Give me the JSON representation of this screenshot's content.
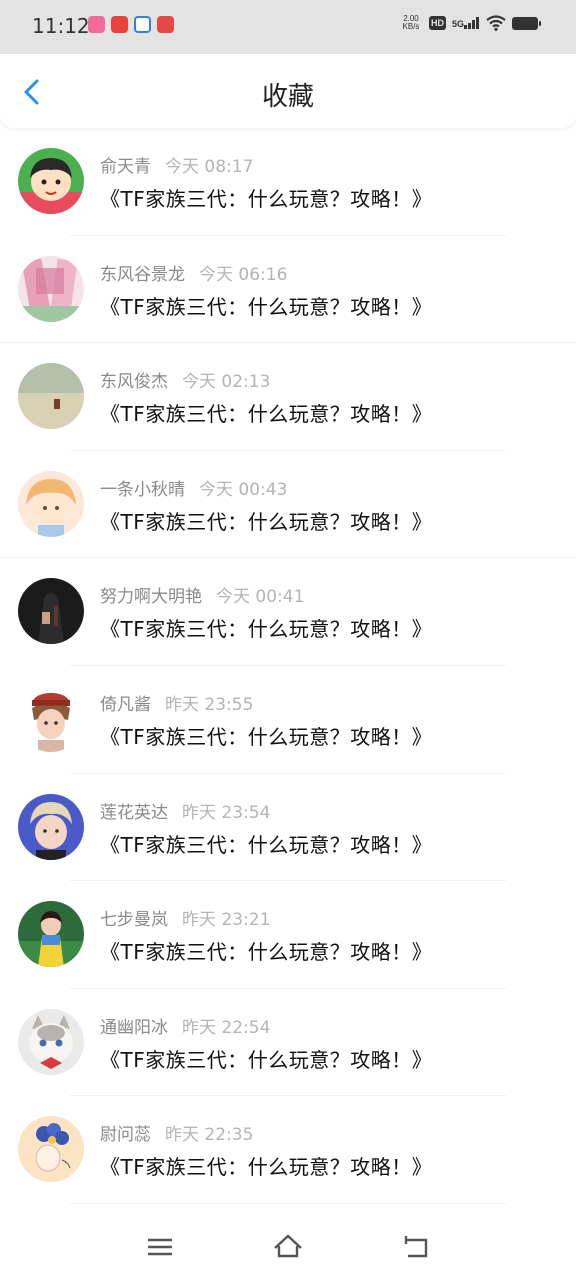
{
  "status_bar": {
    "time": "11:12",
    "net_speed_value": "2.00",
    "net_speed_unit": "KB/s",
    "hd": "HD",
    "network": "5G",
    "notification_icons": [
      "app-icon-pink",
      "app-icon-red",
      "app-icon-blue",
      "app-icon-ticket"
    ]
  },
  "header": {
    "title": "收藏",
    "back_icon": "chevron-left-icon",
    "accent_color": "#2b8ff0"
  },
  "favorites": [
    {
      "name": "俞天青",
      "time": "今天 08:17",
      "title": "《TF家族三代：什么玩意？攻略！》"
    },
    {
      "name": "东风谷景龙",
      "time": "今天 06:16",
      "title": "《TF家族三代：什么玩意？攻略！》"
    },
    {
      "name": "东风俊杰",
      "time": "今天 02:13",
      "title": "《TF家族三代：什么玩意？攻略！》"
    },
    {
      "name": "一条小秋晴",
      "time": "今天 00:43",
      "title": "《TF家族三代：什么玩意？攻略！》"
    },
    {
      "name": "努力啊大明艳",
      "time": "今天 00:41",
      "title": "《TF家族三代：什么玩意？攻略！》"
    },
    {
      "name": "倚凡酱",
      "time": "昨天 23:55",
      "title": "《TF家族三代：什么玩意？攻略！》"
    },
    {
      "name": "莲花英达",
      "time": "昨天 23:54",
      "title": "《TF家族三代：什么玩意？攻略！》"
    },
    {
      "name": "七步曼岚",
      "time": "昨天 23:21",
      "title": "《TF家族三代：什么玩意？攻略！》"
    },
    {
      "name": "通幽阳冰",
      "time": "昨天 22:54",
      "title": "《TF家族三代：什么玩意？攻略！》"
    },
    {
      "name": "尉问蕊",
      "time": "昨天 22:35",
      "title": "《TF家族三代：什么玩意？攻略！》"
    }
  ],
  "nav_bar": {
    "icons": [
      "menu-icon",
      "home-icon",
      "back-icon"
    ]
  }
}
